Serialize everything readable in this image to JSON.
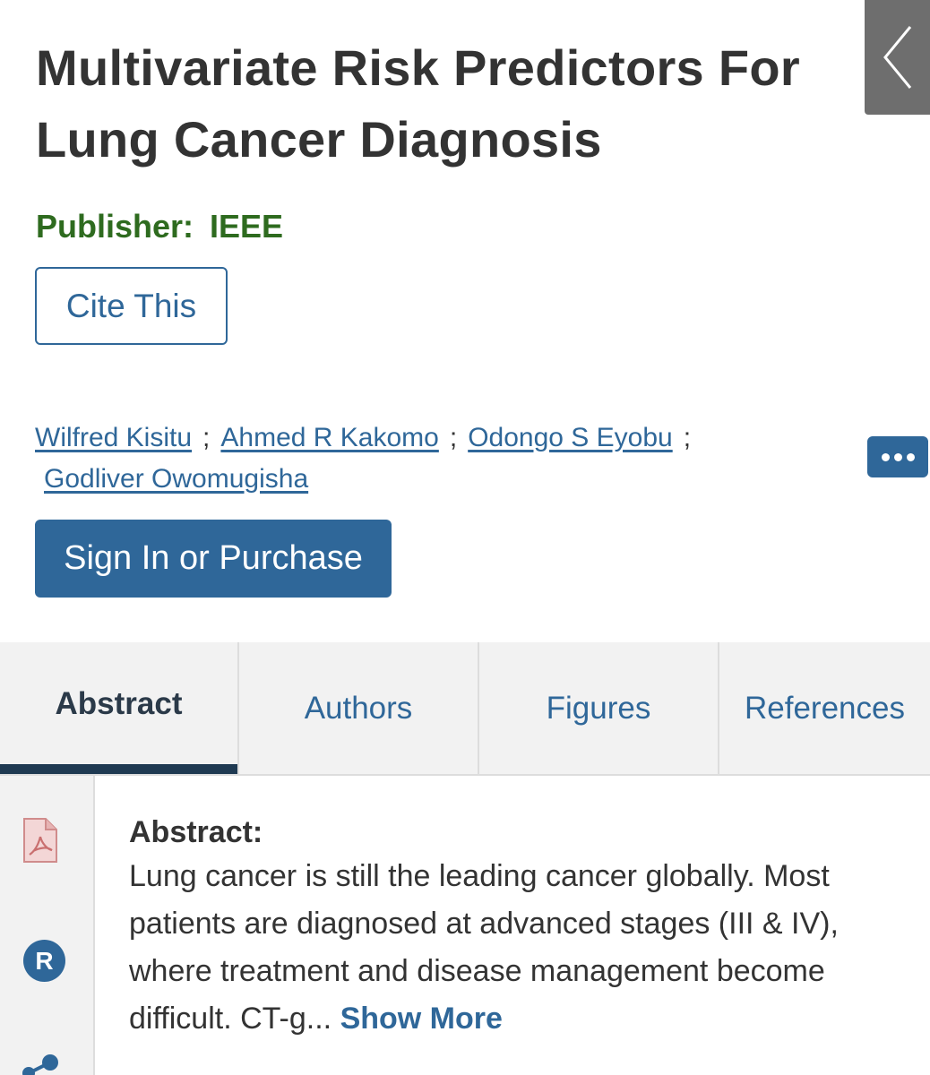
{
  "article": {
    "title": "Multivariate Risk Predictors For Lung Cancer Diagnosis",
    "publisher_label": "Publisher:",
    "publisher_name": "IEEE"
  },
  "actions": {
    "cite_label": "Cite This",
    "signin_label": "Sign In or Purchase"
  },
  "authors": [
    "Wilfred Kisitu",
    "Ahmed R Kakomo",
    "Odongo S Eyobu",
    "Godliver Owomugisha"
  ],
  "author_separator": ";",
  "tabs": [
    {
      "label": "Abstract",
      "active": true
    },
    {
      "label": "Authors",
      "active": false
    },
    {
      "label": "Figures",
      "active": false
    },
    {
      "label": "References",
      "active": false
    }
  ],
  "sidebar": {
    "icons": [
      "pdf-icon",
      "r-icon",
      "share-icon"
    ],
    "r_letter": "R"
  },
  "abstract": {
    "heading": "Abstract:",
    "text": "Lung cancer is still the leading cancer globally. Most patients are diagnosed at advanced stages (III & IV), where treatment and disease management become difficult. CT-g...",
    "show_more_label": "Show More"
  },
  "colors": {
    "link": "#2f6799",
    "publisher": "#2e6b1f",
    "tab_bg": "#f2f2f2",
    "active_underline": "#1f3a52",
    "back_tab": "#6e6e6e"
  },
  "icons": {
    "back": "chevron-left-icon",
    "more": "ellipsis-icon"
  }
}
